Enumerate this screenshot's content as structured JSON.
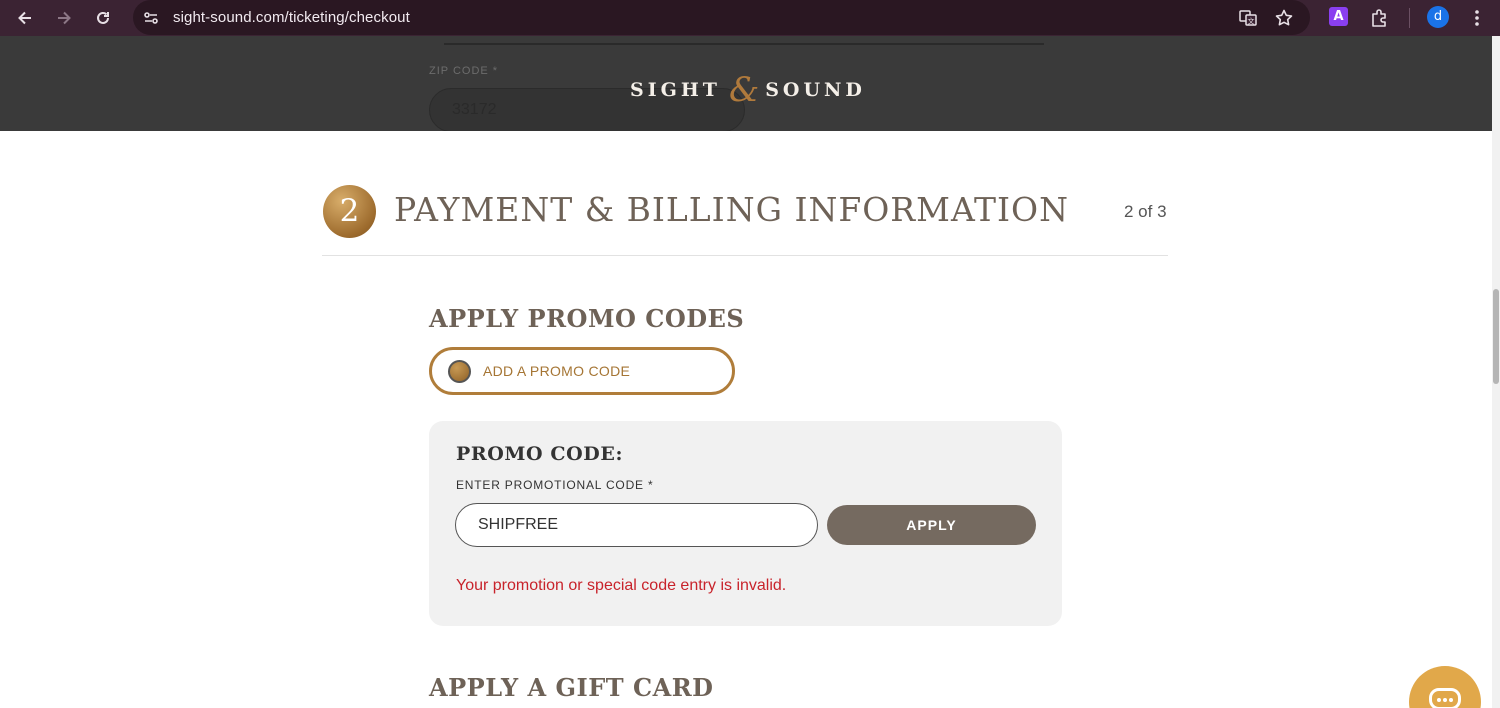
{
  "browser": {
    "url": "sight-sound.com/ticketing/checkout",
    "profile_initial": "d",
    "extension_letter": "A",
    "icons": [
      "back-icon",
      "forward-icon",
      "reload-icon",
      "site-settings-icon",
      "translate-icon",
      "bookmark-star-icon",
      "extensions-icon",
      "menu-icon"
    ]
  },
  "header": {
    "zip_label": "ZIP CODE *",
    "zip_value": "33172",
    "logo_left": "SIGHT",
    "logo_amp": "&",
    "logo_right": "SOUND"
  },
  "section": {
    "step_number": "2",
    "title": "PAYMENT & BILLING INFORMATION",
    "step_count": "2 of 3"
  },
  "promo": {
    "heading": "APPLY PROMO CODES",
    "toggle_label": "ADD A PROMO CODE",
    "panel_title": "PROMO CODE:",
    "field_label": "ENTER PROMOTIONAL CODE *",
    "field_value": "SHIPFREE",
    "apply_label": "APPLY",
    "error": "Your promotion or special code entry is invalid."
  },
  "gift_card": {
    "heading": "APPLY A GIFT CARD"
  },
  "colors": {
    "accent_gold": "#b07d3a",
    "button_brown": "#756a60",
    "error_red": "#c8232b",
    "header_dark": "#3a3a3a",
    "chrome_bg": "#3b2333"
  }
}
